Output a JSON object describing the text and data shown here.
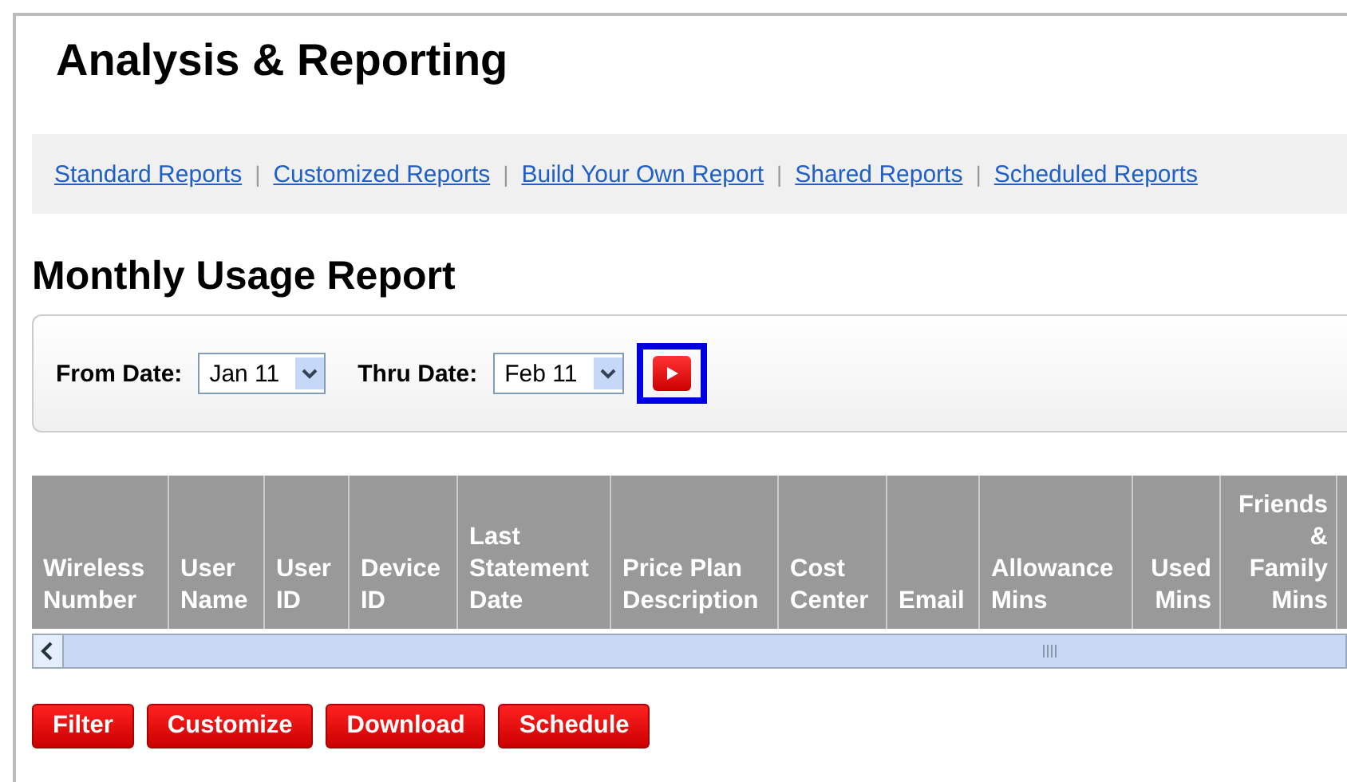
{
  "page_title": "Analysis & Reporting",
  "nav_links": [
    {
      "label": "Standard Reports"
    },
    {
      "label": "Customized Reports"
    },
    {
      "label": "Build Your Own Report"
    },
    {
      "label": "Shared Reports"
    },
    {
      "label": "Scheduled Reports"
    }
  ],
  "nav_separator": "|",
  "report_title": "Monthly Usage Report",
  "filters": [
    {
      "label": "From Date:",
      "value": "Jan 11"
    },
    {
      "label": "Thru Date:",
      "value": "Feb 11"
    }
  ],
  "go_button": {
    "highlighted": true
  },
  "table": {
    "columns": [
      {
        "lines": [
          "Wireless",
          "Number"
        ]
      },
      {
        "lines": [
          "User",
          "Name"
        ]
      },
      {
        "lines": [
          "User",
          "ID"
        ]
      },
      {
        "lines": [
          "Device",
          "ID"
        ]
      },
      {
        "lines": [
          "Last",
          "Statement",
          "Date"
        ]
      },
      {
        "lines": [
          "Price Plan",
          "Description"
        ]
      },
      {
        "lines": [
          "Cost",
          "Center"
        ]
      },
      {
        "lines": [
          "Email"
        ]
      },
      {
        "lines": [
          "Allowance",
          "Mins"
        ]
      },
      {
        "lines": [
          "Used",
          "Mins"
        ]
      },
      {
        "lines": [
          "Friends",
          "&",
          "Family",
          "Mins"
        ]
      }
    ]
  },
  "buttons": [
    {
      "label": "Filter"
    },
    {
      "label": "Customize"
    },
    {
      "label": "Download"
    },
    {
      "label": "Schedule"
    }
  ]
}
